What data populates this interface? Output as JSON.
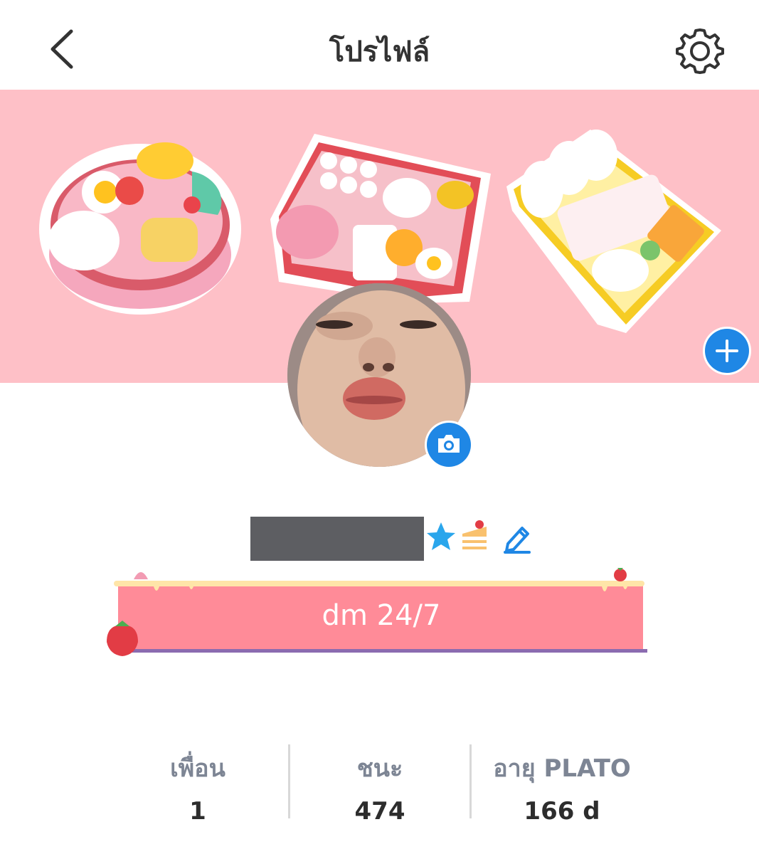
{
  "header": {
    "title": "โปรไฟล์",
    "back_icon": "chevron-left-icon",
    "settings_icon": "gear-icon"
  },
  "cover": {
    "background_color": "#fec0c7",
    "illustrations": [
      "round-bento-box",
      "red-bento-box",
      "yellow-bento-box"
    ]
  },
  "profile": {
    "name_redacted": true,
    "badges": [
      "star-icon",
      "cake-icon"
    ],
    "edit_icon": "pencil-icon",
    "bio": "dm 24/7",
    "bio_color": "#ff8b98"
  },
  "stats": [
    {
      "label": "เพื่อน",
      "value": "1"
    },
    {
      "label": "ชนะ",
      "value": "474"
    },
    {
      "label": "อายุ PLATO",
      "value": "166 d"
    }
  ],
  "accent_color": "#1f87e5"
}
